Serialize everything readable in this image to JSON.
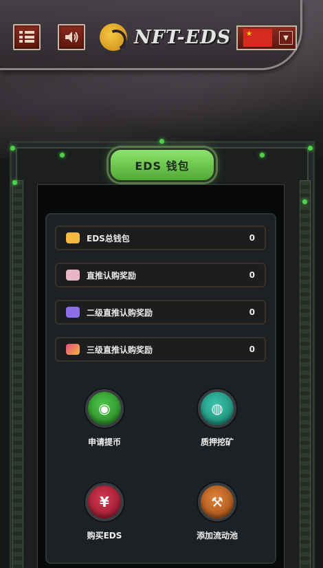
{
  "header": {
    "logo_text": "NFT-EDS",
    "language_flag": "China",
    "menu_icon": "menu-list-icon",
    "sound_icon": "speaker-icon"
  },
  "wallet": {
    "title": "EDS 钱包",
    "rows": [
      {
        "label": "EDS总钱包",
        "value": "0",
        "icon": "wallet-icon",
        "color": "#f5b942"
      },
      {
        "label": "直推认购奖励",
        "value": "0",
        "icon": "reward-badge-icon",
        "color": "#e8b7c7"
      },
      {
        "label": "二级直推认购奖励",
        "value": "0",
        "icon": "reward-badge-icon",
        "color": "#8b6ee8"
      },
      {
        "label": "三级直推认购奖励",
        "value": "0",
        "icon": "reward-badge-icon",
        "color": "#e44b7c"
      }
    ]
  },
  "actions": [
    {
      "label": "申请提币",
      "icon": "coins-icon",
      "color": "#2f9a2a"
    },
    {
      "label": "质押挖矿",
      "icon": "stake-icon",
      "color": "#22a18a"
    },
    {
      "label": "购买EDS",
      "icon": "money-bag-icon",
      "color": "#b21c35"
    },
    {
      "label": "添加流动池",
      "icon": "pickaxe-icon",
      "color": "#c4621f"
    }
  ],
  "colors": {
    "accent_green": "#6bcf4a",
    "header_button": "#7a2318",
    "background": "#151719"
  }
}
